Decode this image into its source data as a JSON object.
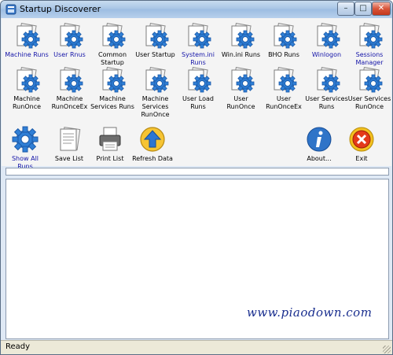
{
  "window": {
    "title": "Startup Discoverer"
  },
  "toolbar": {
    "row1": [
      {
        "label": "Machine Runs",
        "icon": "doc-gear-icon",
        "blue": true
      },
      {
        "label": "User Rnus",
        "icon": "doc-gear-icon",
        "blue": true
      },
      {
        "label": "Common Startup",
        "icon": "doc-gear-icon",
        "blue": false
      },
      {
        "label": "User Startup",
        "icon": "doc-gear-icon",
        "blue": false
      },
      {
        "label": "System.ini Runs",
        "icon": "doc-gear-icon",
        "blue": true
      },
      {
        "label": "Win.ini Runs",
        "icon": "doc-gear-icon",
        "blue": false
      },
      {
        "label": "BHO Runs",
        "icon": "doc-gear-icon",
        "blue": false
      },
      {
        "label": "Winlogon",
        "icon": "doc-gear-icon",
        "blue": true
      },
      {
        "label": "Sessions Manager",
        "icon": "doc-gear-icon",
        "blue": true
      }
    ],
    "row2": [
      {
        "label": "Machine RunOnce",
        "icon": "doc-gear-icon"
      },
      {
        "label": "Machine RunOnceEx",
        "icon": "doc-gear-icon"
      },
      {
        "label": "Machine Services Runs",
        "icon": "doc-gear-icon"
      },
      {
        "label": "Machine Services RunOnce",
        "icon": "doc-gear-icon"
      },
      {
        "label": "User Load Runs",
        "icon": "doc-gear-icon"
      },
      {
        "label": "User RunOnce",
        "icon": "doc-gear-icon"
      },
      {
        "label": "User RunOnceEx",
        "icon": "doc-gear-icon"
      },
      {
        "label": "User Services Runs",
        "icon": "doc-gear-icon"
      },
      {
        "label": "User Services RunOnce",
        "icon": "doc-gear-icon"
      }
    ],
    "row3": {
      "show_all": "Show All Runs",
      "save_list": "Save List",
      "print_list": "Print List",
      "refresh": "Refresh Data",
      "about": "About...",
      "exit": "Exit"
    }
  },
  "watermark": "www.piaodown.com",
  "status": {
    "text": "Ready"
  },
  "colors": {
    "accent_blue": "#1414a8",
    "title_bar": "#b7d0ec"
  }
}
